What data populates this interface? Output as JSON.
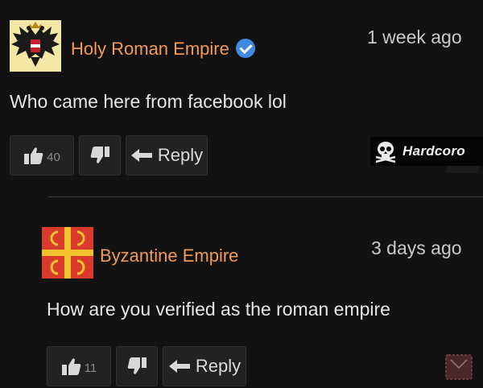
{
  "comments": [
    {
      "author": "Holy Roman Empire",
      "verified": true,
      "time": "1 week ago",
      "text": "Who came here from facebook lol",
      "likes": "40",
      "reply_label": "Reply",
      "avatar_icon": "double-headed-eagle-icon"
    },
    {
      "author": "Byzantine Empire",
      "verified": false,
      "time": "3 days ago",
      "text": "How are you verified as the roman empire",
      "likes": "11",
      "reply_label": "Reply",
      "avatar_icon": "byzantine-flag-icon"
    }
  ],
  "watermark": {
    "label": "Hardcoro",
    "icon": "skull-icon"
  },
  "colors": {
    "background": "#121212",
    "author": "#f39a54",
    "verified": "#3d8ae0",
    "byzantine_red": "#d93a2b",
    "byzantine_gold": "#f2c230"
  }
}
